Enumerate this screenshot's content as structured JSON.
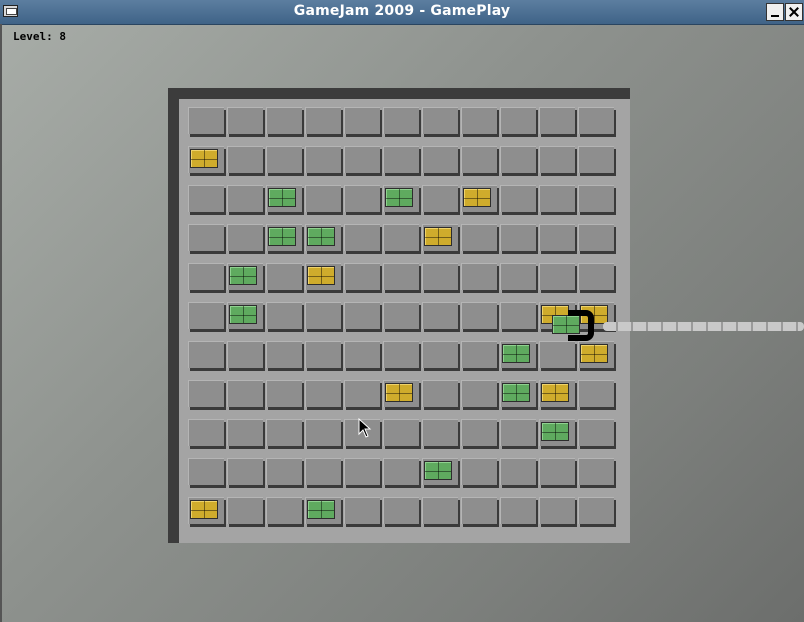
{
  "window": {
    "title": "GameJam 2009 - GamePlay"
  },
  "hud": {
    "level_text": "Level: 8"
  },
  "colors": {
    "green_tile": "#5faa5f",
    "yellow_tile": "#cfac2c",
    "cell": "#8e8e8e",
    "board": "#a4a4a4"
  },
  "grid": {
    "rows": 11,
    "cols": 11,
    "tiles": [
      {
        "row": 1,
        "col": 0,
        "color": "yellow"
      },
      {
        "row": 2,
        "col": 2,
        "color": "green"
      },
      {
        "row": 2,
        "col": 5,
        "color": "green"
      },
      {
        "row": 2,
        "col": 7,
        "color": "yellow"
      },
      {
        "row": 3,
        "col": 2,
        "color": "green"
      },
      {
        "row": 3,
        "col": 3,
        "color": "green"
      },
      {
        "row": 3,
        "col": 6,
        "color": "yellow"
      },
      {
        "row": 4,
        "col": 1,
        "color": "green"
      },
      {
        "row": 4,
        "col": 3,
        "color": "yellow"
      },
      {
        "row": 5,
        "col": 1,
        "color": "green"
      },
      {
        "row": 5,
        "col": 9,
        "color": "yellow"
      },
      {
        "row": 5,
        "col": 10,
        "color": "yellow"
      },
      {
        "row": 6,
        "col": 8,
        "color": "green"
      },
      {
        "row": 6,
        "col": 10,
        "color": "yellow"
      },
      {
        "row": 7,
        "col": 5,
        "color": "yellow"
      },
      {
        "row": 7,
        "col": 8,
        "color": "green"
      },
      {
        "row": 7,
        "col": 9,
        "color": "yellow"
      },
      {
        "row": 8,
        "col": 9,
        "color": "green"
      },
      {
        "row": 9,
        "col": 6,
        "color": "green"
      },
      {
        "row": 10,
        "col": 0,
        "color": "yellow"
      },
      {
        "row": 10,
        "col": 3,
        "color": "green"
      }
    ]
  },
  "crane": {
    "held_tile_color": "green",
    "row": 5,
    "col": 9
  }
}
